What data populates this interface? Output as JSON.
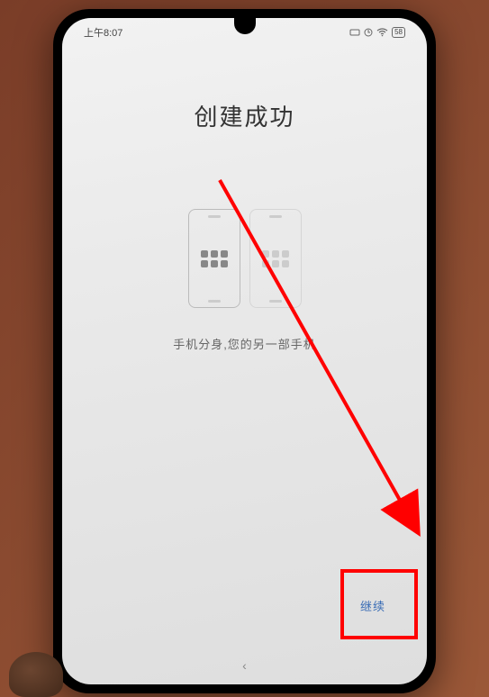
{
  "statusBar": {
    "time": "上午8:07",
    "batteryLevel": "58"
  },
  "main": {
    "title": "创建成功",
    "subtitle": "手机分身,您的另一部手机"
  },
  "actions": {
    "continueLabel": "继续"
  },
  "nav": {
    "backSymbol": "‹"
  }
}
